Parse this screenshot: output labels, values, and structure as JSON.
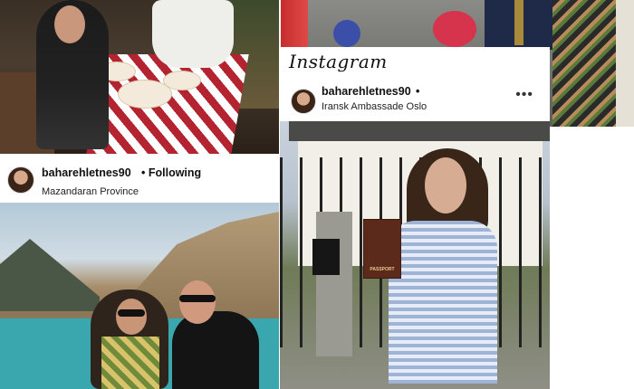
{
  "posts": {
    "embassy": {
      "app_logo": "Instagram",
      "username": "baharehletnes90",
      "separator": "•",
      "location": "Iransk Ambassade Oslo",
      "more_icon": "ellipsis-icon",
      "passport_text": "PASSPORT"
    },
    "mazandaran": {
      "username": "baharehletnes90",
      "follow_status": "• Following",
      "location": "Mazandaran Province"
    }
  }
}
